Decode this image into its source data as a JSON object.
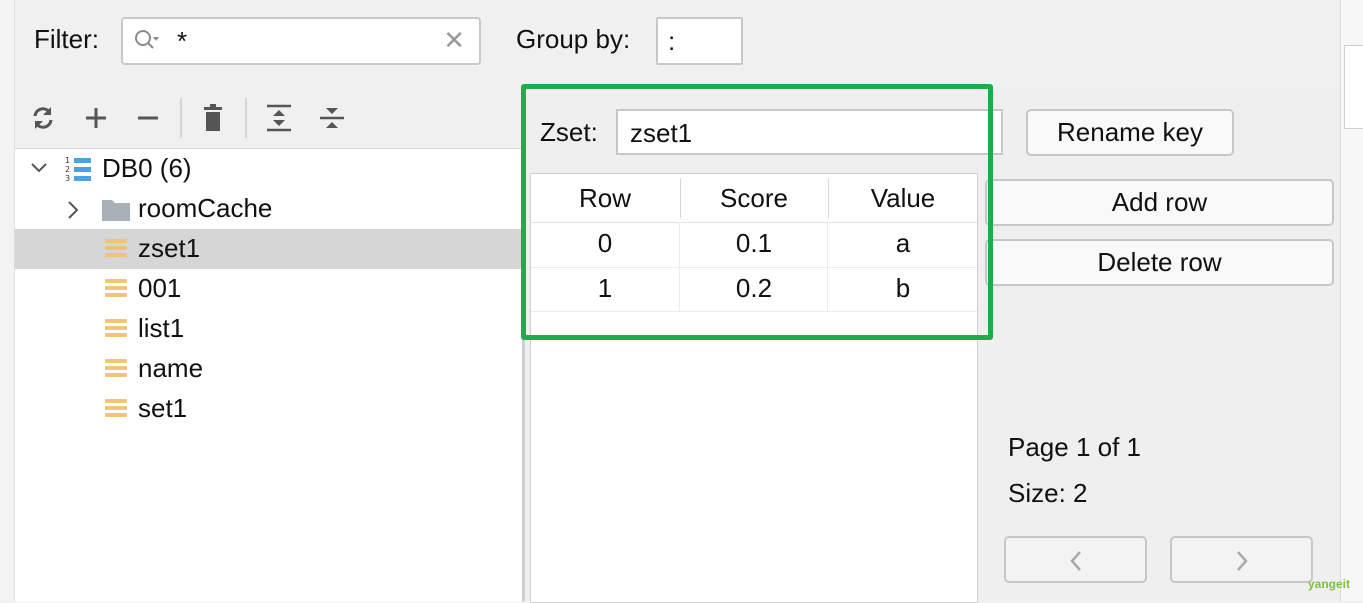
{
  "filter": {
    "label": "Filter:",
    "value": "*"
  },
  "group_by": {
    "label": "Group by:",
    "value": ":"
  },
  "toolbar": {
    "icons": [
      "refresh-icon",
      "add-icon",
      "remove-icon",
      "delete-icon",
      "expand-all-icon",
      "collapse-all-icon"
    ]
  },
  "tree": {
    "db": {
      "label": "DB0 (6)"
    },
    "items": [
      {
        "label": "roomCache",
        "type": "folder",
        "selected": false
      },
      {
        "label": "zset1",
        "type": "key",
        "selected": true
      },
      {
        "label": "001",
        "type": "key",
        "selected": false
      },
      {
        "label": "list1",
        "type": "key",
        "selected": false
      },
      {
        "label": "name",
        "type": "key",
        "selected": false
      },
      {
        "label": "set1",
        "type": "key",
        "selected": false
      }
    ]
  },
  "key_panel": {
    "type_label": "Zset:",
    "key_name": "zset1",
    "rename_label": "Rename key",
    "add_row_label": "Add row",
    "delete_row_label": "Delete row",
    "page_info": "Page 1 of 1",
    "size_info": "Size: 2",
    "prev_label": "<",
    "next_label": ">"
  },
  "table": {
    "columns": [
      "Row",
      "Score",
      "Value"
    ],
    "rows": [
      [
        "0",
        "0.1",
        "a"
      ],
      [
        "1",
        "0.2",
        "b"
      ]
    ]
  },
  "colors": {
    "highlight": "#1fad4b",
    "key_icon": "#f0c478",
    "db_icon": "#4aa3df",
    "folder_icon": "#a9b1b8",
    "selected_row": "#d6d6d6"
  },
  "watermark": "yangeit"
}
